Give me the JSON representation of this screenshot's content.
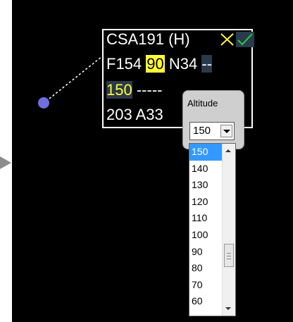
{
  "datablock": {
    "line1": {
      "callsign": "CSA191",
      "wake": "(H)"
    },
    "line2": {
      "prefix": "F154",
      "highlight": "90",
      "suffix": "N34",
      "dashes": "--"
    },
    "line3": {
      "cleared": "150",
      "dashes": "-----"
    },
    "line4": {
      "text": "203 A33"
    }
  },
  "altitude_popup": {
    "title": "Altitude",
    "selected_value": "150",
    "options": [
      "150",
      "140",
      "130",
      "120",
      "110",
      "100",
      "90",
      "80",
      "70",
      "60"
    ],
    "selected_index": 0
  },
  "colors": {
    "background": "#000000",
    "label_text": "#ffffff",
    "highlight_yellow": "#ffff33",
    "aircraft_symbol": "#6f6fe0",
    "check_green": "#22cc44",
    "list_selection": "#3399ff"
  },
  "icons": [
    "cancel-x-icon",
    "confirm-check-icon",
    "scroll-up-arrow-icon",
    "scroll-down-arrow-icon",
    "dropdown-arrow-icon"
  ]
}
